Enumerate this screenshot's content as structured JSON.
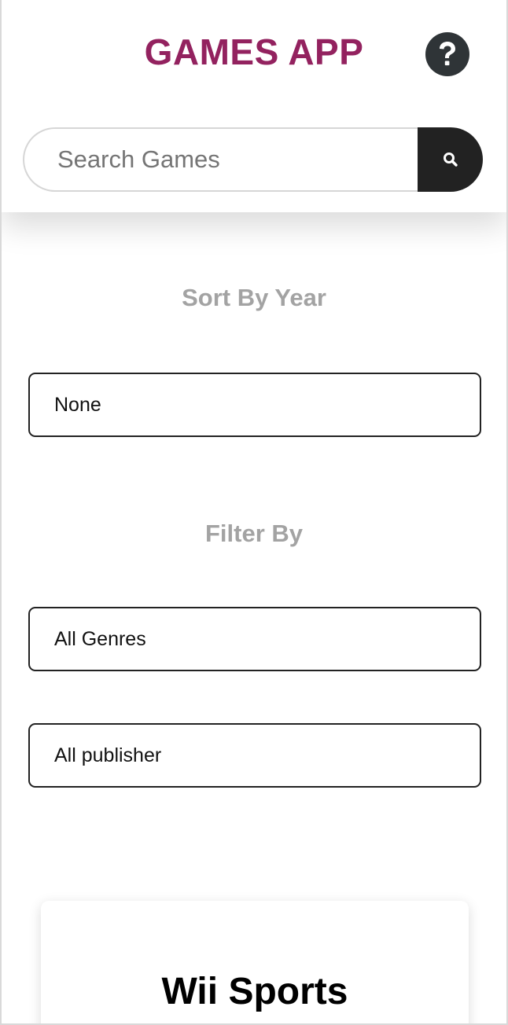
{
  "header": {
    "title": "GAMES APP",
    "title_color": "#93225f",
    "help_icon": "question-circle-icon"
  },
  "search": {
    "placeholder": "Search Games",
    "value": "",
    "button_icon": "search-icon"
  },
  "sort": {
    "heading": "Sort By Year",
    "selected": "None"
  },
  "filter": {
    "heading": "Filter By",
    "genre_selected": "All Genres",
    "publisher_selected": "All publisher"
  },
  "games": [
    {
      "title": "Wii Sports"
    }
  ]
}
